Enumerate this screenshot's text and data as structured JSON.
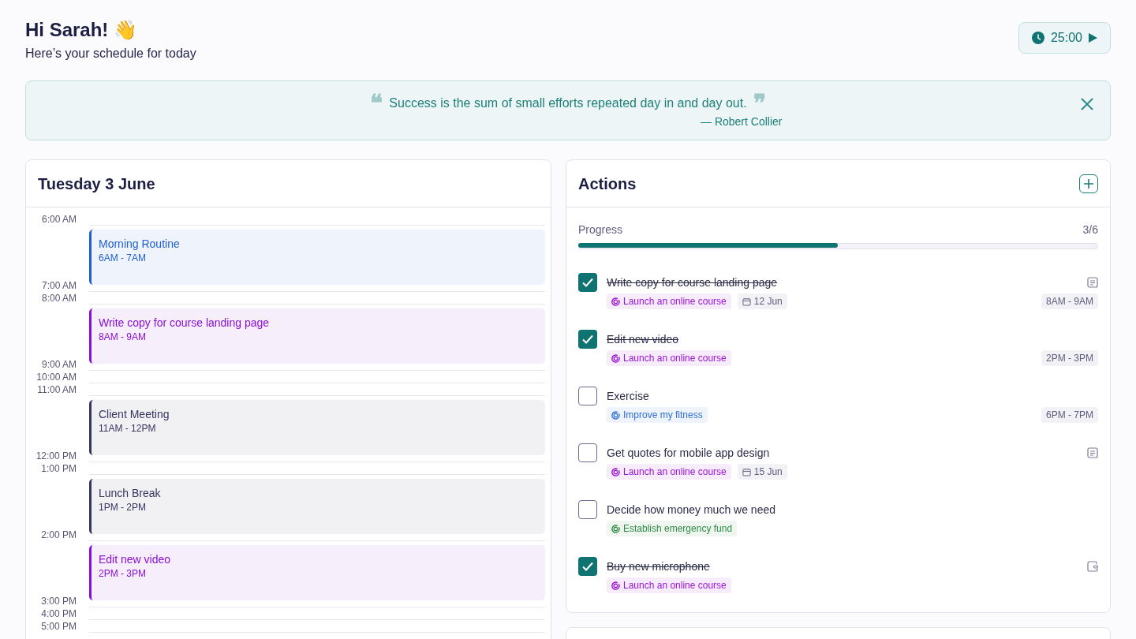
{
  "greeting": {
    "title": "Hi Sarah! 👋",
    "subtitle": "Here’s your schedule for today"
  },
  "timer": {
    "time": "25:00"
  },
  "quote": {
    "open_mark": "❝",
    "text": "Success is the sum of small efforts repeated day in and day out.",
    "close_mark": "❞",
    "author": "— Robert Collier"
  },
  "schedule": {
    "title": "Tuesday 3 June",
    "slots": [
      {
        "time": "6:00 AM",
        "event": {
          "title": "Morning Routine",
          "time": "6AM - 7AM",
          "color": "#1d5fd6"
        }
      },
      {
        "time": "7:00 AM"
      },
      {
        "time": "8:00 AM",
        "event": {
          "title": "Write copy for course landing page",
          "time": "8AM - 9AM",
          "color": "#8a0fd6"
        }
      },
      {
        "time": "9:00 AM"
      },
      {
        "time": "10:00 AM"
      },
      {
        "time": "11:00 AM",
        "event": {
          "title": "Client Meeting",
          "time": "11AM - 12PM",
          "color": "#34345e"
        }
      },
      {
        "time": "12:00 PM"
      },
      {
        "time": "1:00 PM",
        "event": {
          "title": "Lunch Break",
          "time": "1PM - 2PM",
          "color": "#34345e"
        }
      },
      {
        "time": "2:00 PM",
        "event": {
          "title": "Edit new video",
          "time": "2PM - 3PM",
          "color": "#8a0fd6"
        }
      },
      {
        "time": "3:00 PM"
      },
      {
        "time": "4:00 PM"
      },
      {
        "time": "5:00 PM"
      }
    ]
  },
  "actions": {
    "title": "Actions",
    "progress": {
      "label": "Progress",
      "count": "3/6",
      "level": 0.5
    },
    "items": [
      {
        "title": "Write copy for course landing page",
        "checked": true,
        "goal": {
          "text": "Launch an online course",
          "color": "#9b12d9"
        },
        "date": "12 Jun",
        "time": "8AM - 9AM",
        "kind": "note"
      },
      {
        "title": "Edit new video",
        "checked": true,
        "goal": {
          "text": "Launch an online course",
          "color": "#9b12d9"
        },
        "time": "2PM - 3PM"
      },
      {
        "title": "Exercise",
        "checked": false,
        "goal": {
          "text": "Improve my fitness",
          "color": "#2f6fd8"
        },
        "time": "6PM - 7PM"
      },
      {
        "title": "Get quotes for mobile app design",
        "checked": false,
        "goal": {
          "text": "Launch an online course",
          "color": "#9b12d9"
        },
        "date": "15 Jun",
        "kind": "note"
      },
      {
        "title": "Decide how money much we need",
        "checked": false,
        "goal": {
          "text": "Establish emergency fund",
          "color": "#2e8a45"
        }
      },
      {
        "title": "Buy new microphone",
        "checked": true,
        "goal": {
          "text": "Launch an online course",
          "color": "#9b12d9"
        },
        "kind": "wallet"
      }
    ]
  }
}
